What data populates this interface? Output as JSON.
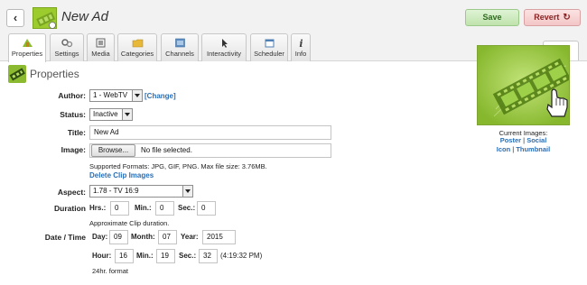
{
  "header": {
    "title": "New Ad",
    "save_label": "Save",
    "revert_label": "Revert"
  },
  "tabs": [
    {
      "label": "Properties",
      "icon": "properties-icon",
      "active": true
    },
    {
      "label": "Settings",
      "icon": "settings-icon"
    },
    {
      "label": "Media",
      "icon": "media-icon"
    },
    {
      "label": "Categories",
      "icon": "categories-icon"
    },
    {
      "label": "Channels",
      "icon": "channels-icon"
    },
    {
      "label": "Interactivity",
      "icon": "interactivity-icon"
    },
    {
      "label": "Scheduler",
      "icon": "scheduler-icon"
    },
    {
      "label": "Info",
      "icon": "info-icon"
    }
  ],
  "panel": {
    "title": "Properties"
  },
  "form": {
    "author_label": "Author:",
    "author_value": "1 - WebTV",
    "change_link": "[Change]",
    "status_label": "Status:",
    "status_value": "Inactive",
    "title_label": "Title:",
    "title_value": "New Ad",
    "image_label": "Image:",
    "browse_label": "Browse...",
    "no_file_text": "No file selected.",
    "formats_note": "Supported Formats: JPG, GIF, PNG. Max file size: 3.76MB.",
    "delete_link": "Delete Clip Images",
    "aspect_label": "Aspect:",
    "aspect_value": "1.78 - TV 16:9",
    "duration_label": "Duration",
    "hrs_label": "Hrs.:",
    "hrs_value": "0",
    "min_label": "Min.:",
    "min_value": "0",
    "sec_label": "Sec.:",
    "sec_value": "0",
    "duration_note": "Approximate Clip duration.",
    "datetime_label": "Date / Time",
    "day_label": "Day:",
    "day_value": "09",
    "month_label": "Month:",
    "month_value": "07",
    "year_label": "Year:",
    "year_value": "2015",
    "hour_label": "Hour:",
    "hour_value": "16",
    "tmin_label": "Min.:",
    "tmin_value": "19",
    "tsec_label": "Sec.:",
    "tsec_value": "32",
    "time_display": "(4:19:32 PM)",
    "format_note": "24hr. format"
  },
  "preview": {
    "current_label": "Current Images:",
    "poster": "Poster",
    "social": "Social",
    "icon": "Icon",
    "thumbnail": "Thumbnail",
    "sep": "|"
  },
  "colors": {
    "brand_green": "#96c83a",
    "link_blue": "#2a6fb5",
    "save_green": "#bfe3ac",
    "revert_red": "#f3c6c6"
  }
}
